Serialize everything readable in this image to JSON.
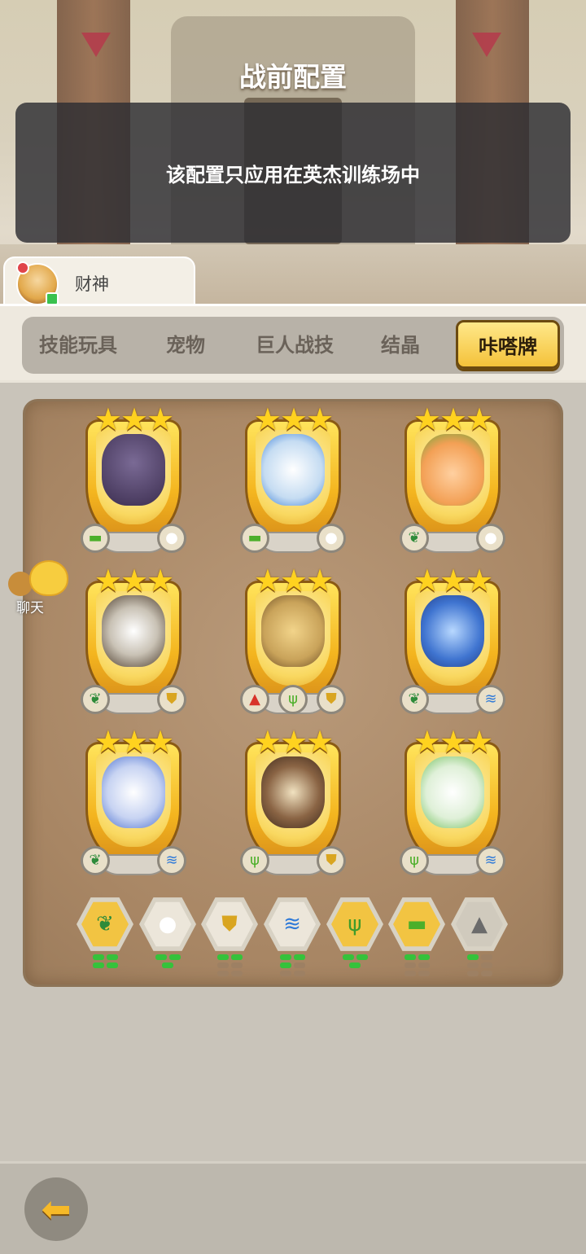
{
  "header": {
    "title": "战前配置",
    "notice": "该配置只应用在英杰训练场中"
  },
  "player": {
    "name": "财神"
  },
  "tabs": [
    {
      "label": "技能玩具",
      "active": false
    },
    {
      "label": "宠物",
      "active": false
    },
    {
      "label": "巨人战技",
      "active": false
    },
    {
      "label": "结晶",
      "active": false
    },
    {
      "label": "咔嗒牌",
      "active": true
    }
  ],
  "chat": {
    "label": "聊天"
  },
  "cards": [
    {
      "stars": "★★★",
      "attrs": [
        "slime-icon",
        "wool-icon"
      ]
    },
    {
      "stars": "★★★",
      "attrs": [
        "slime-icon",
        "wool-icon"
      ]
    },
    {
      "stars": "★★★",
      "attrs": [
        "leaf-icon",
        "wool-icon"
      ]
    },
    {
      "stars": "★★★",
      "attrs": [
        "leaf-icon",
        "shield-icon"
      ]
    },
    {
      "stars": "★★★",
      "attrs": [
        "lava-icon",
        "cactus-icon",
        "shield-icon"
      ]
    },
    {
      "stars": "★★★",
      "attrs": [
        "leaf-icon",
        "tornado-icon"
      ]
    },
    {
      "stars": "★★★",
      "attrs": [
        "leaf-icon",
        "tornado-icon"
      ]
    },
    {
      "stars": "★★★",
      "attrs": [
        "cactus-icon",
        "shield-icon"
      ]
    },
    {
      "stars": "★★★",
      "attrs": [
        "cactus-icon",
        "tornado-icon"
      ]
    }
  ],
  "synergies": [
    {
      "icon": "leaf-icon",
      "active": 4,
      "total": 4
    },
    {
      "icon": "wool-icon",
      "active": 3,
      "total": 3
    },
    {
      "icon": "shield-icon",
      "active": 2,
      "total": 6
    },
    {
      "icon": "tornado-icon",
      "active": 3,
      "total": 6
    },
    {
      "icon": "cactus-icon",
      "active": 3,
      "total": 3
    },
    {
      "icon": "slime-icon",
      "active": 2,
      "total": 6
    },
    {
      "icon": "mountain-icon",
      "active": 1,
      "total": 6
    }
  ],
  "colors": {
    "accent": "#f4c23a",
    "pip_on": "#35c23b",
    "panel": "#a88664"
  }
}
